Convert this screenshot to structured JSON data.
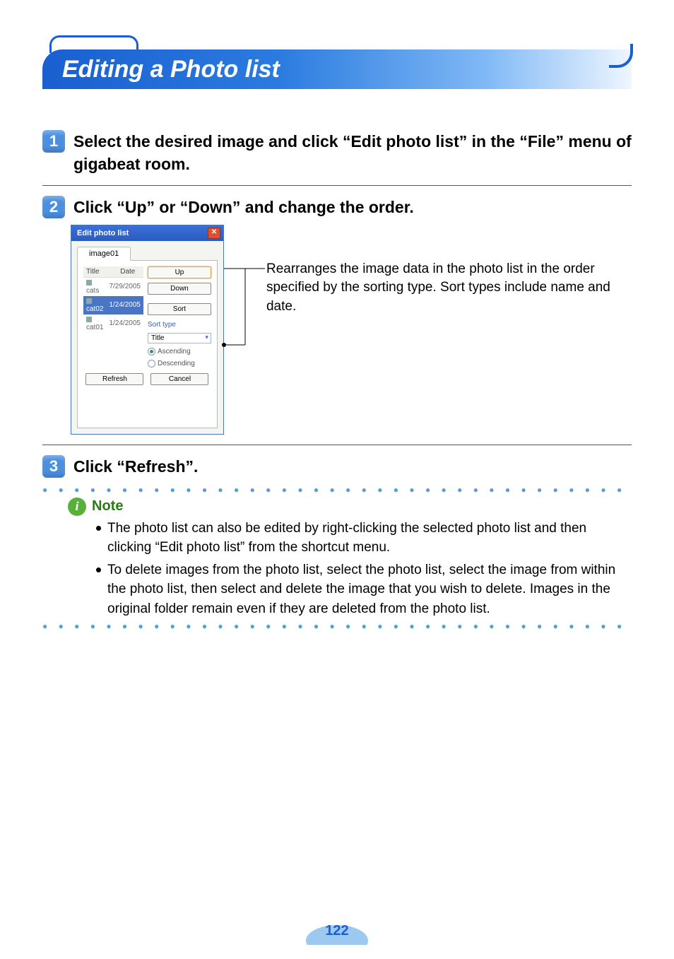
{
  "title": "Editing a Photo list",
  "steps": {
    "s1": {
      "num": "1",
      "text": "Select the desired image and click “Edit photo list” in the “File” menu of gigabeat room."
    },
    "s2": {
      "num": "2",
      "text": "Click “Up” or “Down” and change the order."
    },
    "s3": {
      "num": "3",
      "text": "Click “Refresh”."
    }
  },
  "dialog": {
    "title": "Edit photo list",
    "tab": "image01",
    "columns": {
      "title": "Title",
      "date": "Date"
    },
    "rows": [
      {
        "title": "cats",
        "date": "7/29/2005",
        "selected": false
      },
      {
        "title": "cat02",
        "date": "1/24/2005",
        "selected": true
      },
      {
        "title": "cat01",
        "date": "1/24/2005",
        "selected": false
      }
    ],
    "buttons": {
      "up": "Up",
      "down": "Down",
      "sort": "Sort",
      "refresh": "Refresh",
      "cancel": "Cancel"
    },
    "sort": {
      "label": "Sort type",
      "selected": "Title",
      "asc": "Ascending",
      "desc": "Descending"
    }
  },
  "callout": "Rearranges the image data in the photo list in the order specified by the sorting type. Sort types include name and date.",
  "note": {
    "heading": "Note",
    "items": [
      "The photo list can also be edited by right-clicking the selected photo list and then clicking “Edit photo list” from the shortcut menu.",
      "To delete images from the photo list, select the photo list, select the image from within the photo list, then select and delete the image that you wish to delete. Images in the original folder remain even if they are deleted from the photo list."
    ]
  },
  "page_number": "122"
}
